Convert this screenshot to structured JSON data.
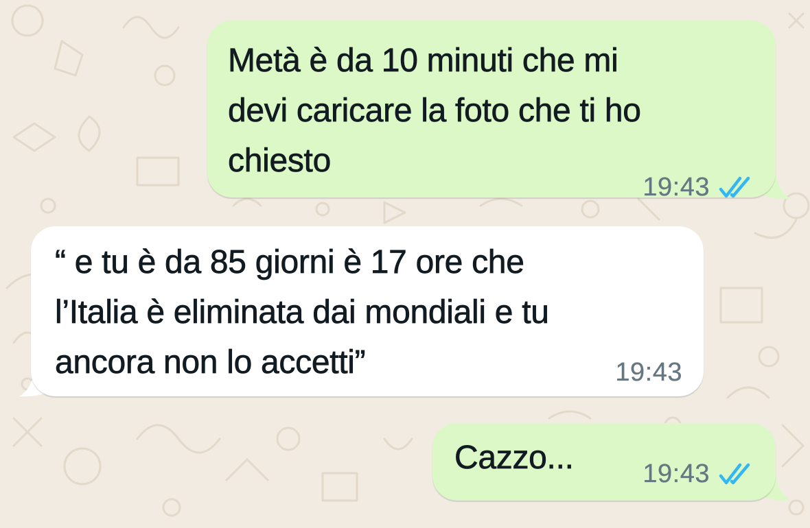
{
  "chat": {
    "wallpaper": "whatsapp-doodle-pattern",
    "colors": {
      "background": "#f1ebe1",
      "outgoing_bubble": "#dcf8c6",
      "incoming_bubble": "#ffffff",
      "timestamp": "#667781",
      "read_ticks": "#34b7f1"
    },
    "messages": [
      {
        "direction": "outgoing",
        "text": "Metà è da 10 minuti che mi\ndevi caricare la foto che ti ho\nchiesto",
        "time": "19:43",
        "status": "read",
        "status_icon": "double-check-icon"
      },
      {
        "direction": "incoming",
        "text": "“ e tu è da 85 giorni è 17 ore che\nl’Italia è eliminata dai mondiali e tu\nancora non lo accetti”",
        "time": "19:43"
      },
      {
        "direction": "outgoing",
        "text": "Cazzo...",
        "time": "19:43",
        "status": "read",
        "status_icon": "double-check-icon"
      }
    ]
  }
}
